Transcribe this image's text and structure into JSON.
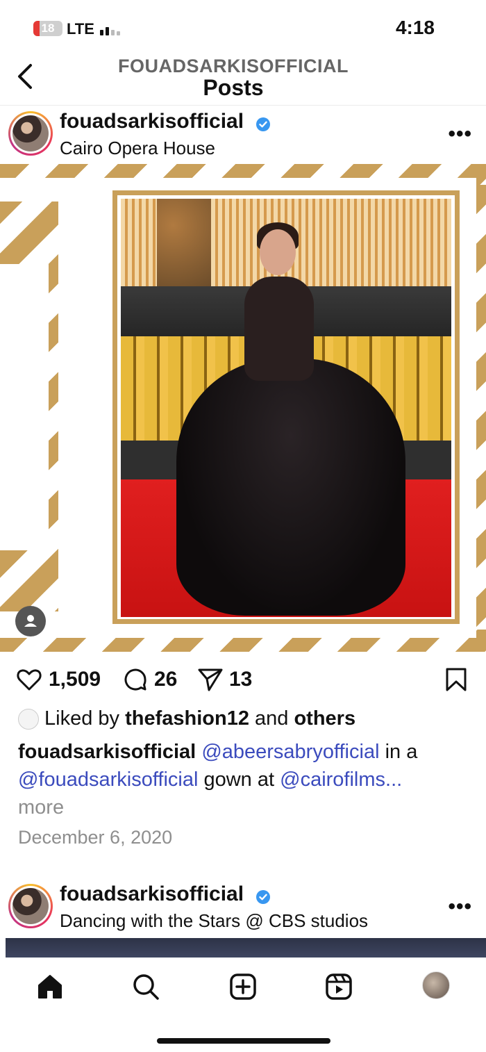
{
  "status_bar": {
    "battery": "18",
    "network": "LTE",
    "time": "4:18"
  },
  "header": {
    "account": "FOUADSARKISOFFICIAL",
    "title": "Posts"
  },
  "post1": {
    "username": "fouadsarkisofficial",
    "location": "Cairo Opera House",
    "likes": "1,509",
    "comments": "26",
    "shares": "13",
    "liked_by_prefix": "Liked by",
    "liked_by_user": "thefashion12",
    "liked_by_and": "and",
    "liked_by_others": "others",
    "caption_user": "fouadsarkisofficial",
    "mention1": "@abeersabryofficial",
    "text1": "in a",
    "mention2": "@fouadsarkisofficial",
    "text2": "gown at",
    "mention3": "@cairofilms...",
    "more": "more",
    "date": "December 6, 2020"
  },
  "post2": {
    "username": "fouadsarkisofficial",
    "location": "Dancing with the Stars @ CBS studios"
  },
  "icons": {
    "back": "chevron-left-icon",
    "verified": "verified-badge-icon",
    "like": "heart-icon",
    "comment": "comment-icon",
    "share": "send-icon",
    "save": "bookmark-icon",
    "home": "home-icon",
    "search": "search-icon",
    "create": "plus-square-icon",
    "reels": "reels-icon"
  },
  "colors": {
    "mention": "#3b4bbd",
    "verified": "#3897f0",
    "frame_gold": "#c9a05a",
    "muted": "#8e8e8e"
  }
}
